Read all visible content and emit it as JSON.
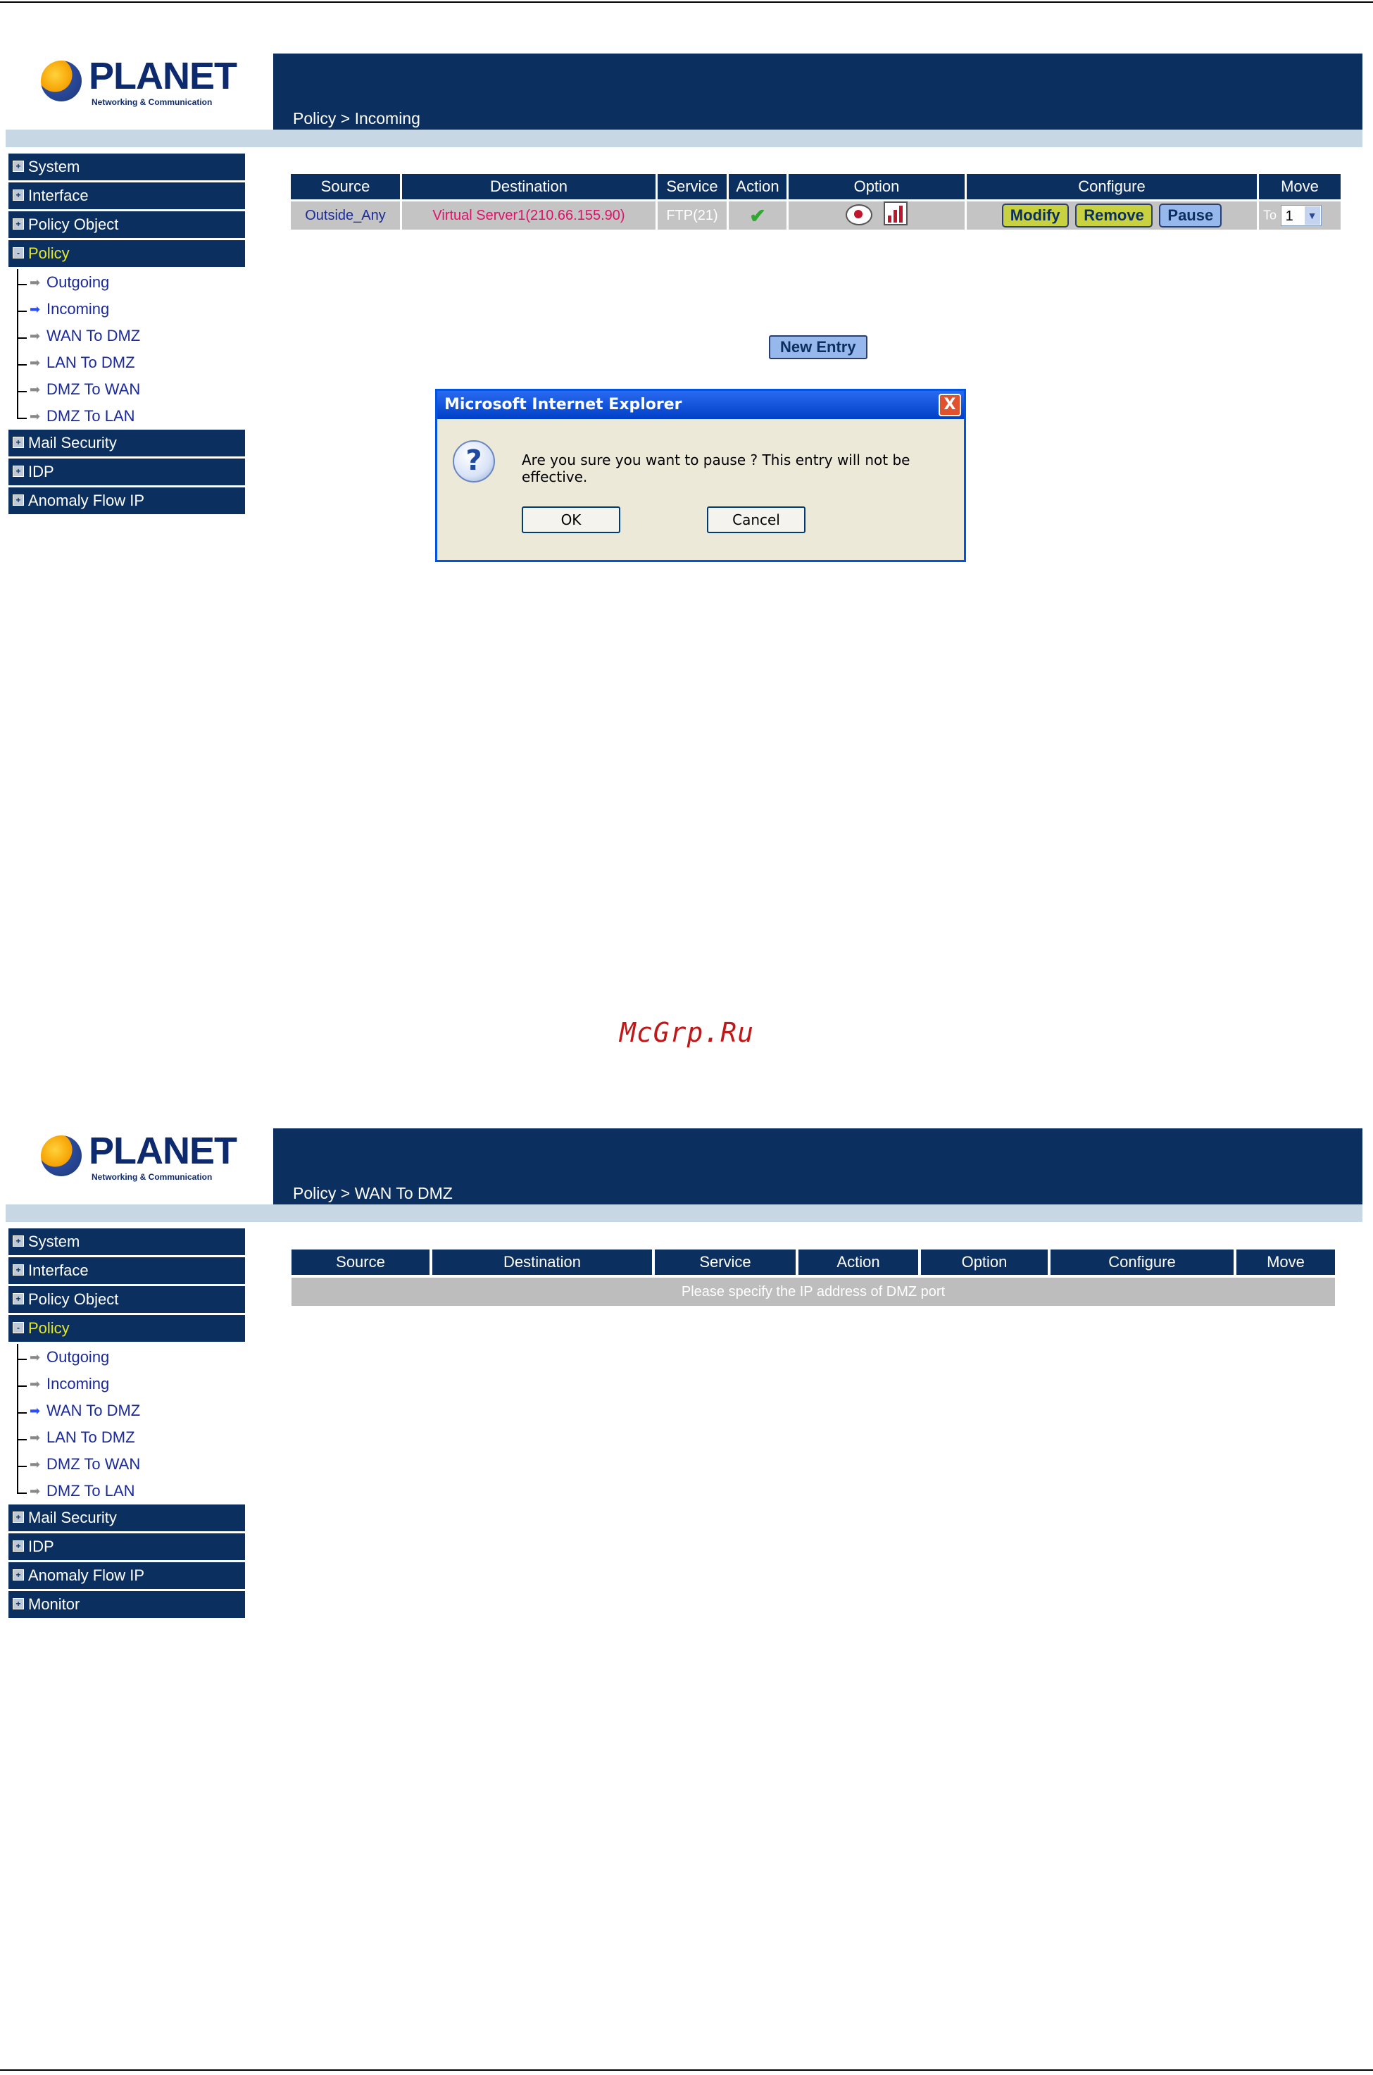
{
  "screen1": {
    "logo": {
      "brand": "PLANET",
      "tagline": "Networking & Communication"
    },
    "breadcrumb": "Policy > Incoming",
    "sidebar": {
      "top_items": [
        {
          "label": "System",
          "marker": "+"
        },
        {
          "label": "Interface",
          "marker": "+"
        },
        {
          "label": "Policy Object",
          "marker": "+"
        },
        {
          "label": "Policy",
          "marker": "-"
        }
      ],
      "sub_items": [
        {
          "label": "Outgoing"
        },
        {
          "label": "Incoming"
        },
        {
          "label": "WAN To DMZ"
        },
        {
          "label": "LAN To DMZ"
        },
        {
          "label": "DMZ To WAN"
        },
        {
          "label": "DMZ To LAN"
        }
      ],
      "bottom_items": [
        {
          "label": "Mail Security",
          "marker": "+"
        },
        {
          "label": "IDP",
          "marker": "+"
        },
        {
          "label": "Anomaly Flow IP",
          "marker": "+"
        }
      ]
    },
    "table": {
      "headers": [
        "Source",
        "Destination",
        "Service",
        "Action",
        "Option",
        "Configure",
        "Move"
      ],
      "row": {
        "source": "Outside_Any",
        "destination": "Virtual Server1(210.66.155.90)",
        "service": "FTP(21)",
        "action_icon": "checkmark-icon",
        "option_icons": [
          "eye-icon",
          "chart-icon"
        ],
        "configure_buttons": [
          "Modify",
          "Remove",
          "Pause"
        ],
        "move_prefix": "To",
        "move_value": "1"
      }
    },
    "new_entry_button": "New Entry",
    "dialog": {
      "title": "Microsoft Internet Explorer",
      "message": "Are you sure you want to pause ? This entry will not be effective.",
      "ok": "OK",
      "cancel": "Cancel",
      "icon": "question-icon",
      "close_glyph": "X"
    }
  },
  "watermark": "McGrp.Ru",
  "screen2": {
    "logo": {
      "brand": "PLANET",
      "tagline": "Networking & Communication"
    },
    "breadcrumb": "Policy > WAN To DMZ",
    "sidebar": {
      "top_items": [
        {
          "label": "System",
          "marker": "+"
        },
        {
          "label": "Interface",
          "marker": "+"
        },
        {
          "label": "Policy Object",
          "marker": "+"
        },
        {
          "label": "Policy",
          "marker": "-"
        }
      ],
      "sub_items": [
        {
          "label": "Outgoing"
        },
        {
          "label": "Incoming"
        },
        {
          "label": "WAN To DMZ"
        },
        {
          "label": "LAN To DMZ"
        },
        {
          "label": "DMZ To WAN"
        },
        {
          "label": "DMZ To LAN"
        }
      ],
      "bottom_items": [
        {
          "label": "Mail Security",
          "marker": "+"
        },
        {
          "label": "IDP",
          "marker": "+"
        },
        {
          "label": "Anomaly Flow IP",
          "marker": "+"
        },
        {
          "label": "Monitor",
          "marker": "+"
        }
      ]
    },
    "table": {
      "headers": [
        "Source",
        "Destination",
        "Service",
        "Action",
        "Option",
        "Configure",
        "Move"
      ],
      "message": "Please specify the IP address of DMZ port"
    }
  },
  "colors": {
    "navy": "#0b2f5f",
    "strip": "#c8d7e4",
    "active_menu": "#e6e62a",
    "link": "#1a2a9a"
  }
}
